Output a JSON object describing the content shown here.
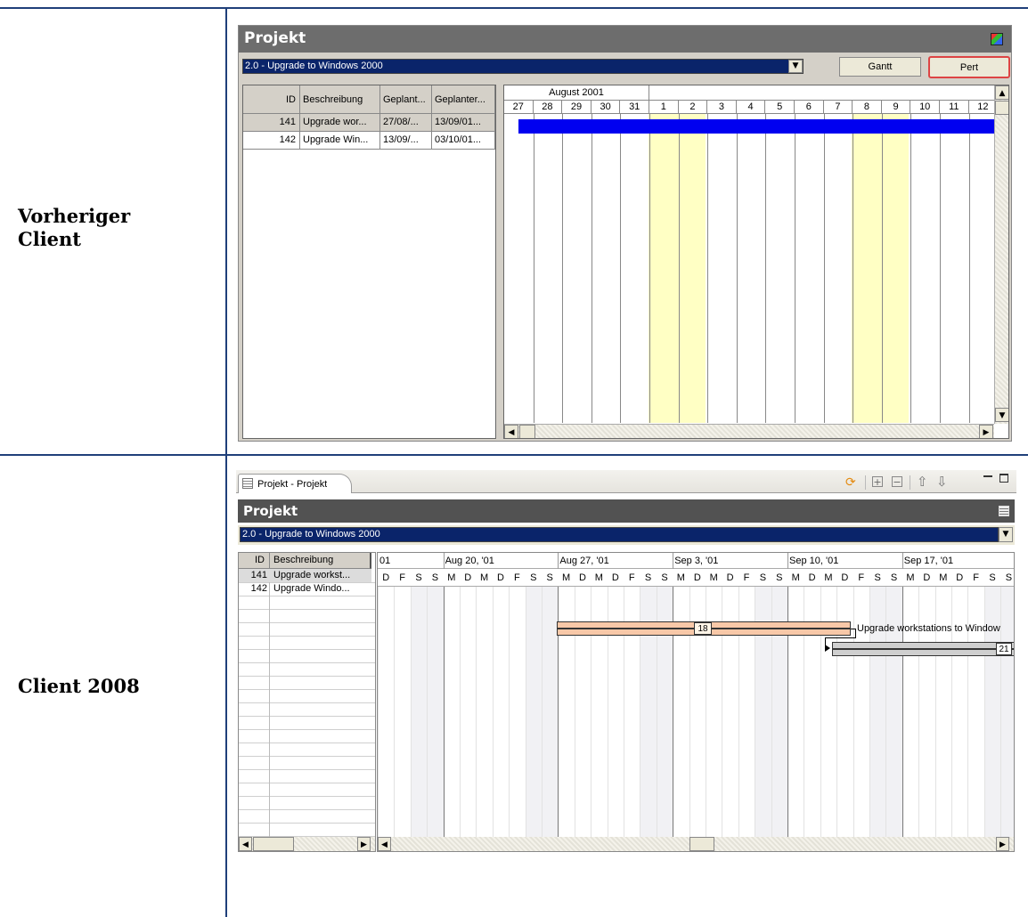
{
  "rows": [
    {
      "label": "Vorheriger\nClient"
    },
    {
      "label": "Client 2008"
    }
  ],
  "old_client": {
    "title": "Projekt",
    "project_select": "2.0 - Upgrade to Windows 2000",
    "gantt_button": "Gantt",
    "pert_button": "Pert",
    "columns": [
      "ID",
      "Beschreibung",
      "Geplant...",
      "Geplanter..."
    ],
    "tasks": [
      {
        "id": "141",
        "desc": "Upgrade wor...",
        "start": "27/08/...",
        "end": "13/09/01..."
      },
      {
        "id": "142",
        "desc": "Upgrade Win...",
        "start": "13/09/...",
        "end": "03/10/01..."
      }
    ],
    "month_label": "August 2001",
    "days": [
      "27",
      "28",
      "29",
      "30",
      "31",
      "1",
      "2",
      "3",
      "4",
      "5",
      "6",
      "7",
      "8",
      "9",
      "10",
      "11",
      "12"
    ]
  },
  "new_client": {
    "tab_label": "Projekt - Projekt",
    "title": "Projekt",
    "project_select": "2.0 - Upgrade to Windows 2000",
    "columns": [
      "ID",
      "Beschreibung"
    ],
    "tasks": [
      {
        "id": "141",
        "desc": "Upgrade workst..."
      },
      {
        "id": "142",
        "desc": "Upgrade Windo..."
      }
    ],
    "weeks": [
      "01",
      "Aug 20, '01",
      "Aug 27, '01",
      "Sep 3, '01",
      "Sep 10, '01",
      "Sep 17, '01",
      "S"
    ],
    "day_letters_partial": [
      "D",
      "F",
      "S",
      "S"
    ],
    "day_letters_week": [
      "M",
      "D",
      "M",
      "D",
      "F",
      "S",
      "S"
    ],
    "bar1_duration": "18",
    "bar1_label": "Upgrade workstations to Window",
    "bar2_duration": "21"
  }
}
